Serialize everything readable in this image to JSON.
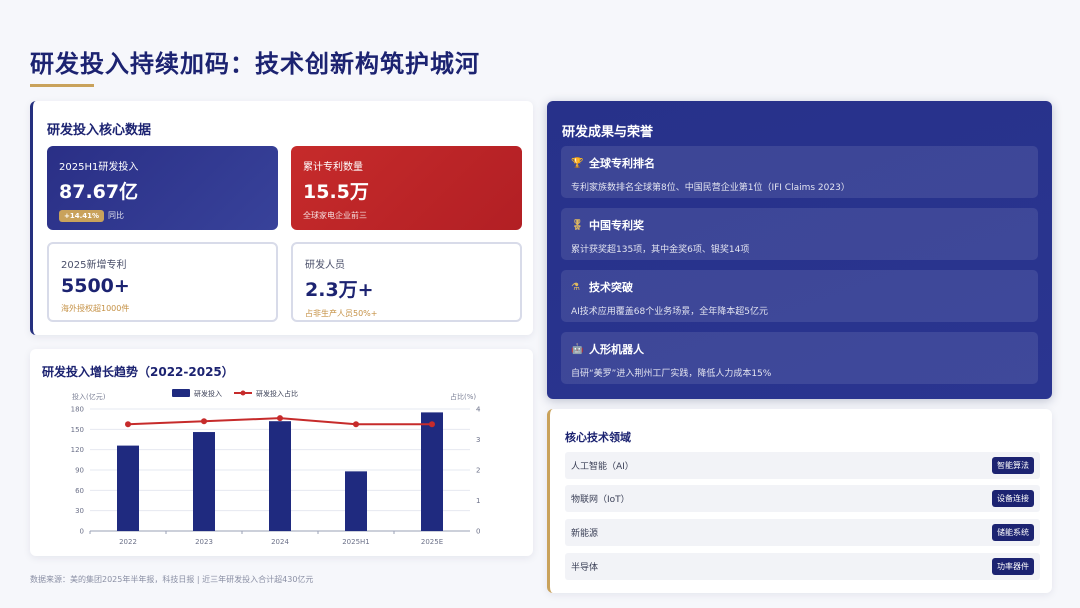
{
  "page": {
    "title": "研发投入持续加码：技术创新构筑护城河",
    "footnote": "数据来源：美的集团2025年半年报，科技日报 | 近三年研发投入合计超430亿元"
  },
  "core": {
    "title": "研发投入核心数据",
    "stats": [
      {
        "label": "2025H1研发投入",
        "value": "87.67亿",
        "badge": "+14.41%",
        "sub": "同比"
      },
      {
        "label": "累计专利数量",
        "value": "15.5万",
        "sub": "全球家电企业前三"
      },
      {
        "label": "2025新增专利",
        "value": "5500+",
        "sub": "海外授权超1000件"
      },
      {
        "label": "研发人员",
        "value": "2.3万+",
        "sub": "占非生产人员50%+"
      }
    ]
  },
  "chart_section": {
    "title": "研发投入增长趋势（2022-2025）"
  },
  "chart_data": {
    "type": "bar",
    "categories": [
      "2022",
      "2023",
      "2024",
      "2025H1",
      "2025E"
    ],
    "series": [
      {
        "name": "研发投入",
        "type": "bar",
        "axis": "left",
        "values": [
          126,
          146,
          162,
          88,
          175
        ],
        "color": "#1f2a7f"
      },
      {
        "name": "研发投入占比",
        "type": "line",
        "axis": "right",
        "values": [
          3.5,
          3.6,
          3.7,
          3.5,
          3.5
        ],
        "color": "#c62b2b"
      }
    ],
    "ylabel": "投入(亿元)",
    "y2label": "占比(%)",
    "ylim": [
      0,
      180
    ],
    "yticks": [
      0,
      30,
      60,
      90,
      120,
      150,
      180
    ],
    "y2lim": [
      0,
      4
    ],
    "y2ticks": [
      0,
      1,
      2,
      3,
      4
    ],
    "legend": "top-center",
    "grid": true
  },
  "achievements": {
    "title": "研发成果与荣誉",
    "items": [
      {
        "icon": "trophy-icon",
        "glyph": "🏆",
        "title": "全球专利排名",
        "desc": "专利家族数排名全球第8位、中国民营企业第1位（IFI Claims 2023）"
      },
      {
        "icon": "medal-icon",
        "glyph": "🎖",
        "title": "中国专利奖",
        "desc": "累计获奖超135项，其中金奖6项、银奖14项"
      },
      {
        "icon": "flask-icon",
        "glyph": "⚗",
        "title": "技术突破",
        "desc": "AI技术应用覆盖68个业务场景，全年降本超5亿元"
      },
      {
        "icon": "robot-icon",
        "glyph": "🤖",
        "title": "人形机器人",
        "desc": "自研“美罗”进入荆州工厂实践，降低人力成本15%"
      }
    ]
  },
  "tech": {
    "title": "核心技术领域",
    "rows": [
      {
        "name": "人工智能（AI）",
        "tag": "智能算法"
      },
      {
        "name": "物联网（IoT）",
        "tag": "设备连接"
      },
      {
        "name": "新能源",
        "tag": "储能系统"
      },
      {
        "name": "半导体",
        "tag": "功率器件"
      }
    ]
  }
}
